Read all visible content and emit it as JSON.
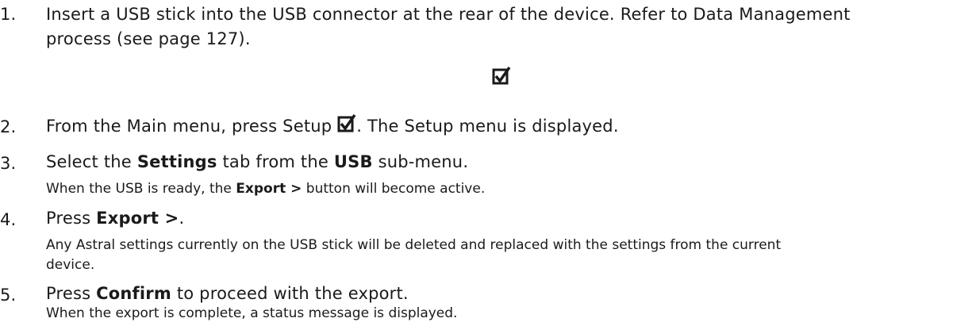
{
  "steps": [
    {
      "number": "1.",
      "text_line1": "Insert a USB stick into the USB connector at the rear of the device. Refer to Data Management",
      "text_line2": "process (see page 127)."
    },
    {
      "number": "2.",
      "text_before": "From the Main menu, press Setup",
      "text_after": ". The Setup menu is displayed.",
      "icon": "setup-checkbox-icon"
    },
    {
      "number": "3.",
      "text_a": "Select the",
      "bold_a": "Settings",
      "text_b": "tab from the",
      "bold_b": "USB",
      "text_c": "sub-menu.",
      "note_a": "When the USB is ready, the",
      "note_bold": "Export >",
      "note_b": "button will become active."
    },
    {
      "number": "4.",
      "text_a": "Press",
      "bold_a": "Export >",
      "text_b": ".",
      "note_line1": "Any Astral settings currently on the USB stick will be deleted and replaced with the settings from the current",
      "note_line2": "device."
    },
    {
      "number": "5.",
      "text_a": "Press",
      "bold_a": "Confirm",
      "text_b": "to proceed with the export.",
      "note": "When the export is complete, a status message is displayed."
    }
  ]
}
